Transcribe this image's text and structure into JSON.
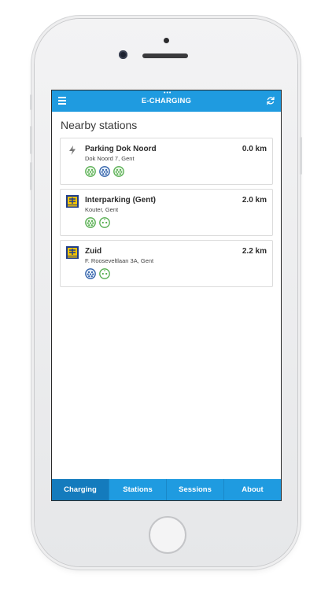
{
  "app": {
    "title": "E-CHARGING",
    "accent_color": "#1f9be0",
    "active_tab_color": "#147bbd",
    "menu_icon": "hamburger-icon",
    "refresh_icon": "refresh-icon"
  },
  "main": {
    "section_title": "Nearby stations",
    "stations": [
      {
        "name": "Parking Dok Noord",
        "address": "Dok Noord 7, Gent",
        "distance": "0.0 km",
        "logo": "lightning-icon",
        "connectors": [
          "type2-connector-green",
          "type2-connector-blue",
          "type2-connector-green"
        ]
      },
      {
        "name": "Interparking (Gent)",
        "address": "Kouter, Gent",
        "distance": "2.0 km",
        "logo": "interparking-logo",
        "connectors": [
          "type2-connector-green",
          "schuko-connector-green"
        ]
      },
      {
        "name": "Zuid",
        "address": "F. Rooseveltlaan 3A, Gent",
        "distance": "2.2 km",
        "logo": "interparking-logo",
        "connectors": [
          "type2-connector-blue",
          "schuko-connector-green"
        ]
      }
    ]
  },
  "tabs": [
    {
      "label": "Charging",
      "active": true
    },
    {
      "label": "Stations",
      "active": false
    },
    {
      "label": "Sessions",
      "active": false
    },
    {
      "label": "About",
      "active": false
    }
  ]
}
